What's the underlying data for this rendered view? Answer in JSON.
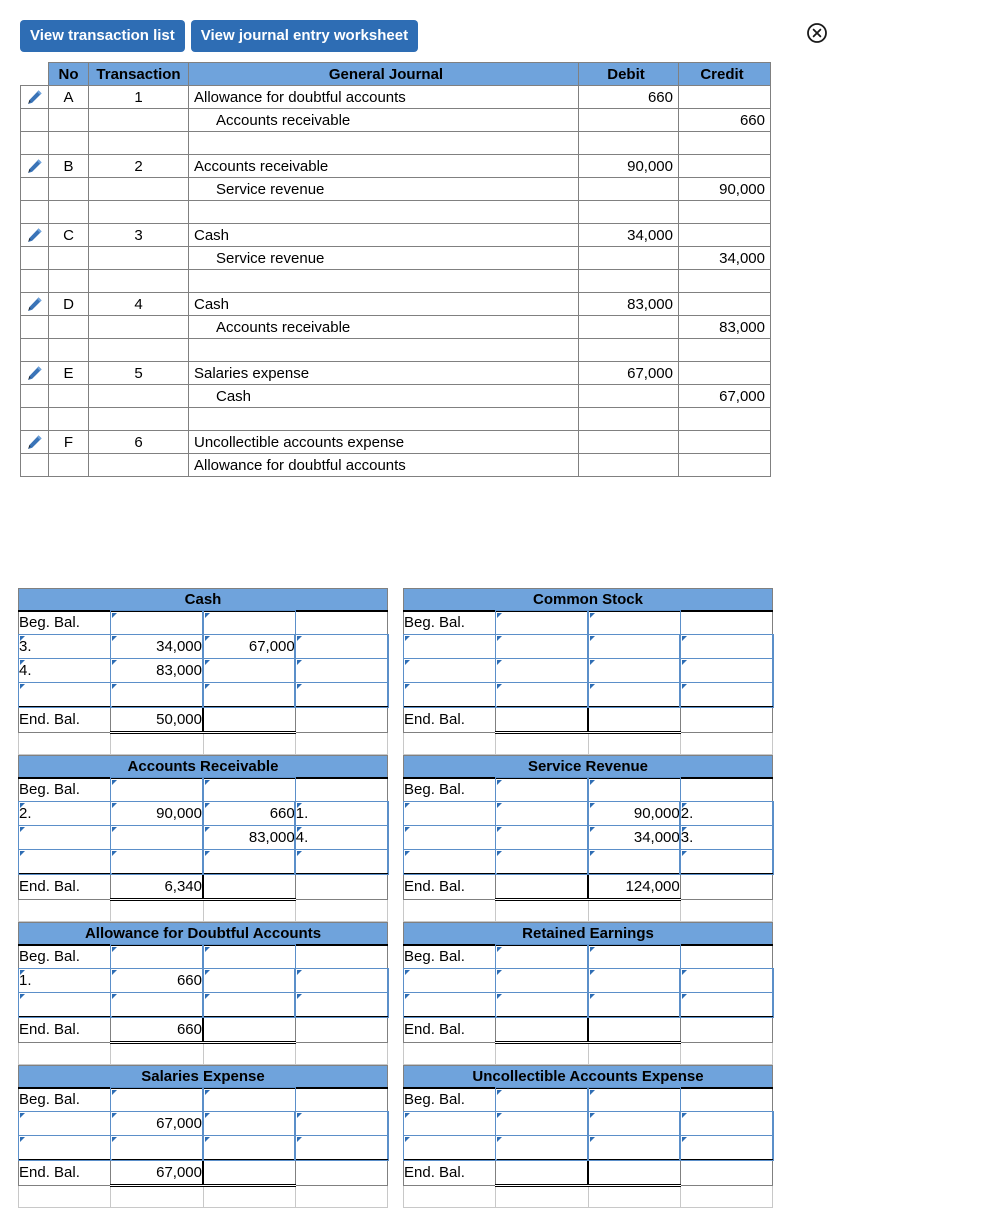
{
  "tabs": [
    {
      "label": "View transaction list",
      "name": "tab-transaction-list"
    },
    {
      "label": "View journal entry worksheet",
      "name": "tab-journal-worksheet"
    }
  ],
  "close_icon": "close-circle-icon",
  "colors": {
    "tab_blue": "#2E6DB4",
    "header_blue": "#6FA3DC",
    "cell_border_blue": "#5B8FC9",
    "grid_gray": "#808080"
  },
  "journal": {
    "headers": {
      "no": "No",
      "transaction": "Transaction",
      "general_journal": "General Journal",
      "debit": "Debit",
      "credit": "Credit"
    },
    "edit_icon": "pencil-edit-icon",
    "entries": [
      {
        "no": "A",
        "transaction": "1",
        "lines": [
          {
            "account": "Allowance for doubtful accounts",
            "indent": false,
            "debit": "660",
            "credit": ""
          },
          {
            "account": "Accounts receivable",
            "indent": true,
            "debit": "",
            "credit": "660"
          }
        ]
      },
      {
        "no": "B",
        "transaction": "2",
        "lines": [
          {
            "account": "Accounts receivable",
            "indent": false,
            "debit": "90,000",
            "credit": ""
          },
          {
            "account": "Service revenue",
            "indent": true,
            "debit": "",
            "credit": "90,000"
          }
        ]
      },
      {
        "no": "C",
        "transaction": "3",
        "lines": [
          {
            "account": "Cash",
            "indent": false,
            "debit": "34,000",
            "credit": ""
          },
          {
            "account": "Service revenue",
            "indent": true,
            "debit": "",
            "credit": "34,000"
          }
        ]
      },
      {
        "no": "D",
        "transaction": "4",
        "lines": [
          {
            "account": "Cash",
            "indent": false,
            "debit": "83,000",
            "credit": ""
          },
          {
            "account": "Accounts receivable",
            "indent": true,
            "debit": "",
            "credit": "83,000"
          }
        ]
      },
      {
        "no": "E",
        "transaction": "5",
        "lines": [
          {
            "account": "Salaries expense",
            "indent": false,
            "debit": "67,000",
            "credit": ""
          },
          {
            "account": "Cash",
            "indent": true,
            "debit": "",
            "credit": "67,000"
          }
        ]
      },
      {
        "no": "F",
        "transaction": "6",
        "lines": [
          {
            "account": "Uncollectible accounts expense",
            "indent": false,
            "debit": "",
            "credit": ""
          },
          {
            "account": "Allowance for doubtful accounts",
            "indent": false,
            "debit": "",
            "credit": ""
          }
        ]
      }
    ]
  },
  "ledger": {
    "beg_bal_label": "Beg. Bal.",
    "end_bal_label": "End. Bal.",
    "accounts": [
      {
        "title": "Cash",
        "name": "t-account-cash",
        "rows": [
          {
            "label": "Beg. Bal.",
            "label_input": false,
            "debit": "",
            "credit": "",
            "label2": ""
          },
          {
            "label": "3.",
            "label_input": true,
            "debit": "34,000",
            "credit": "67,000",
            "label2": ""
          },
          {
            "label": "4.",
            "label_input": true,
            "debit": "83,000",
            "credit": "",
            "label2": ""
          },
          {
            "label": "",
            "label_input": true,
            "debit": "",
            "credit": "",
            "label2": ""
          }
        ],
        "end_debit": "50,000",
        "end_credit": ""
      },
      {
        "title": "Common Stock",
        "name": "t-account-common-stock",
        "rows": [
          {
            "label": "Beg. Bal.",
            "label_input": false,
            "debit": "",
            "credit": "",
            "label2": ""
          },
          {
            "label": "",
            "label_input": true,
            "debit": "",
            "credit": "",
            "label2": ""
          },
          {
            "label": "",
            "label_input": true,
            "debit": "",
            "credit": "",
            "label2": ""
          },
          {
            "label": "",
            "label_input": true,
            "debit": "",
            "credit": "",
            "label2": ""
          }
        ],
        "end_debit": "",
        "end_credit": ""
      },
      {
        "title": "Accounts Receivable",
        "name": "t-account-accounts-receivable",
        "rows": [
          {
            "label": "Beg. Bal.",
            "label_input": false,
            "debit": "",
            "credit": "",
            "label2": ""
          },
          {
            "label": "2.",
            "label_input": true,
            "debit": "90,000",
            "credit": "660",
            "label2": "1."
          },
          {
            "label": "",
            "label_input": true,
            "debit": "",
            "credit": "83,000",
            "label2": "4."
          },
          {
            "label": "",
            "label_input": true,
            "debit": "",
            "credit": "",
            "label2": ""
          }
        ],
        "end_debit": "6,340",
        "end_credit": ""
      },
      {
        "title": "Service Revenue",
        "name": "t-account-service-revenue",
        "rows": [
          {
            "label": "Beg. Bal.",
            "label_input": false,
            "debit": "",
            "credit": "",
            "label2": ""
          },
          {
            "label": "",
            "label_input": true,
            "debit": "",
            "credit": "90,000",
            "label2": "2."
          },
          {
            "label": "",
            "label_input": true,
            "debit": "",
            "credit": "34,000",
            "label2": "3."
          },
          {
            "label": "",
            "label_input": true,
            "debit": "",
            "credit": "",
            "label2": ""
          }
        ],
        "end_debit": "",
        "end_credit": "124,000"
      },
      {
        "title": "Allowance for Doubtful Accounts",
        "name": "t-account-allowance-doubtful-accounts",
        "rows": [
          {
            "label": "Beg. Bal.",
            "label_input": false,
            "debit": "",
            "credit": "",
            "label2": ""
          },
          {
            "label": "1.",
            "label_input": true,
            "debit": "660",
            "credit": "",
            "label2": ""
          },
          {
            "label": "",
            "label_input": true,
            "debit": "",
            "credit": "",
            "label2": ""
          }
        ],
        "end_debit": "660",
        "end_credit": ""
      },
      {
        "title": "Retained Earnings",
        "name": "t-account-retained-earnings",
        "rows": [
          {
            "label": "Beg. Bal.",
            "label_input": false,
            "debit": "",
            "credit": "",
            "label2": ""
          },
          {
            "label": "",
            "label_input": true,
            "debit": "",
            "credit": "",
            "label2": ""
          },
          {
            "label": "",
            "label_input": true,
            "debit": "",
            "credit": "",
            "label2": ""
          }
        ],
        "end_debit": "",
        "end_credit": ""
      },
      {
        "title": "Salaries Expense",
        "name": "t-account-salaries-expense",
        "rows": [
          {
            "label": "Beg. Bal.",
            "label_input": false,
            "debit": "",
            "credit": "",
            "label2": ""
          },
          {
            "label": "",
            "label_input": true,
            "debit": "67,000",
            "credit": "",
            "label2": ""
          },
          {
            "label": "",
            "label_input": true,
            "debit": "",
            "credit": "",
            "label2": ""
          }
        ],
        "end_debit": "67,000",
        "end_credit": ""
      },
      {
        "title": "Uncollectible Accounts Expense",
        "name": "t-account-uncollectible-accounts-expense",
        "rows": [
          {
            "label": "Beg. Bal.",
            "label_input": false,
            "debit": "",
            "credit": "",
            "label2": ""
          },
          {
            "label": "",
            "label_input": true,
            "debit": "",
            "credit": "",
            "label2": ""
          },
          {
            "label": "",
            "label_input": true,
            "debit": "",
            "credit": "",
            "label2": ""
          }
        ],
        "end_debit": "",
        "end_credit": ""
      }
    ]
  }
}
